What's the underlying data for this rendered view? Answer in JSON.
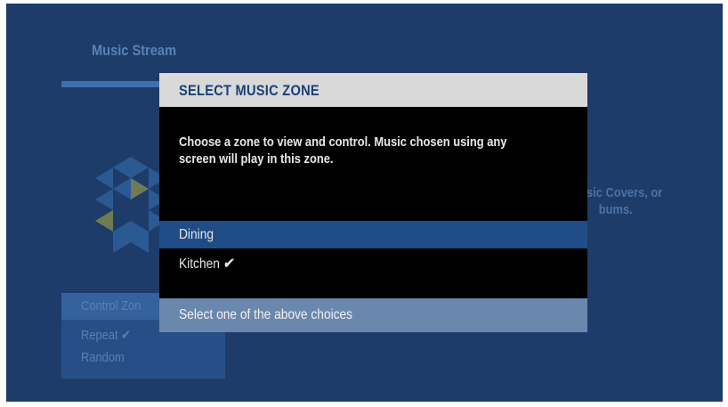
{
  "background": {
    "title": "Music Stream",
    "side_text_line1": "sic Covers, or",
    "side_text_line2": "bums.",
    "menu": [
      {
        "label": "Control Zon",
        "active": true
      },
      {
        "label": "Repeat ✔",
        "active": false
      },
      {
        "label": "Random",
        "active": false
      }
    ]
  },
  "dialog": {
    "title": "SELECT MUSIC ZONE",
    "message": "Choose a zone to view and control.  Music chosen using any screen will play in this zone.",
    "options": [
      {
        "label": "Dining",
        "selected": true,
        "checked": false
      },
      {
        "label": "Kitchen",
        "selected": false,
        "checked": true
      }
    ],
    "check_glyph": "✔",
    "footer": "Select one of the above choices"
  },
  "colors": {
    "screen_bg": "#1d3c6a",
    "dialog_bg": "#000000",
    "header_bg": "#d9d9d9",
    "title_text": "#1b3f7a",
    "selected_bg": "#1f4b87",
    "footer_bg": "#6a87ad"
  }
}
